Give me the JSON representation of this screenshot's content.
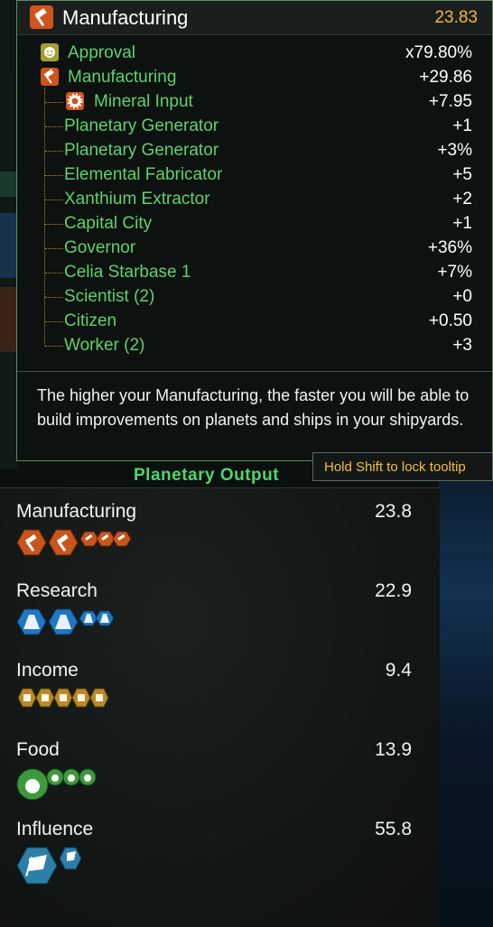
{
  "tooltip": {
    "title": "Manufacturing",
    "total": "23.83",
    "header_icon": "hammer-icon",
    "rows": [
      {
        "label": "Approval",
        "value": "x79.80%",
        "icon": "smiley-icon"
      },
      {
        "label": "Manufacturing",
        "value": "+29.86",
        "icon": "hammer-icon"
      },
      {
        "label": "Mineral Input",
        "value": "+7.95",
        "icon": "gear-icon"
      },
      {
        "label": "Planetary Generator",
        "value": "+1"
      },
      {
        "label": "Planetary Generator",
        "value": "+3%"
      },
      {
        "label": "Elemental Fabricator",
        "value": "+5"
      },
      {
        "label": "Xanthium Extractor",
        "value": "+2"
      },
      {
        "label": "Capital City",
        "value": "+1"
      },
      {
        "label": "Governor",
        "value": "+36%"
      },
      {
        "label": "Celia Starbase 1",
        "value": "+7%"
      },
      {
        "label": "Scientist (2)",
        "value": "+0"
      },
      {
        "label": "Citizen",
        "value": "+0.50"
      },
      {
        "label": "Worker (2)",
        "value": "+3"
      }
    ],
    "description": "The higher your Manufacturing, the faster you will be able to build improvements on planets and ships in your shipyards.",
    "lock_hint": "Hold Shift to lock tooltip"
  },
  "output": {
    "title": "Planetary Output",
    "resources": [
      {
        "name": "Manufacturing",
        "value": "23.8",
        "icon": "hammer-icon",
        "color": "#c9541c"
      },
      {
        "name": "Research",
        "value": "22.9",
        "icon": "flask-icon",
        "color": "#1f78c2"
      },
      {
        "name": "Income",
        "value": "9.4",
        "icon": "credits-icon",
        "color": "#b98a2a"
      },
      {
        "name": "Food",
        "value": "13.9",
        "icon": "apple-icon",
        "color": "#3d9a3c"
      },
      {
        "name": "Influence",
        "value": "55.8",
        "icon": "flag-icon",
        "color": "#2b7fa8"
      }
    ]
  },
  "colors": {
    "label_green": "#5dd36e",
    "total_orange": "#f2b644",
    "tree_line": "#b0882a"
  }
}
